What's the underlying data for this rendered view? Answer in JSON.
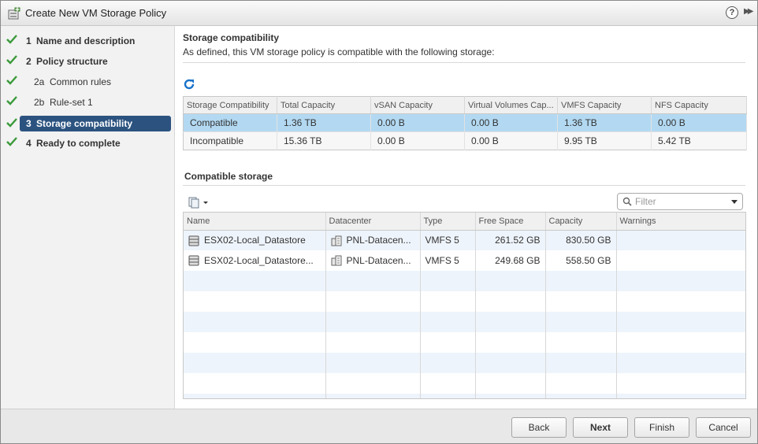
{
  "window": {
    "title": "Create New VM Storage Policy"
  },
  "nav": {
    "steps": [
      {
        "num": "1",
        "label": "Name and description"
      },
      {
        "num": "2",
        "label": "Policy structure"
      },
      {
        "num": "2a",
        "label": "Common rules"
      },
      {
        "num": "2b",
        "label": "Rule-set 1"
      },
      {
        "num": "3",
        "label": "Storage compatibility"
      },
      {
        "num": "4",
        "label": "Ready to complete"
      }
    ]
  },
  "compat": {
    "heading": "Storage compatibility",
    "description": "As defined, this VM storage policy is compatible with the following storage:",
    "columns": [
      "Storage Compatibility",
      "Total Capacity",
      "vSAN Capacity",
      "Virtual Volumes Cap...",
      "VMFS Capacity",
      "NFS Capacity"
    ],
    "rows": [
      [
        "Compatible",
        "1.36 TB",
        "0.00 B",
        "0.00 B",
        "1.36 TB",
        "0.00 B"
      ],
      [
        "Incompatible",
        "15.36 TB",
        "0.00 B",
        "0.00 B",
        "9.95 TB",
        "5.42 TB"
      ]
    ]
  },
  "storage": {
    "heading": "Compatible storage",
    "filter_placeholder": "Filter",
    "columns": [
      "Name",
      "Datacenter",
      "Type",
      "Free Space",
      "Capacity",
      "Warnings"
    ],
    "rows": [
      [
        "ESX02-Local_Datastore",
        "PNL-Datacen...",
        "VMFS 5",
        "261.52 GB",
        "830.50 GB",
        ""
      ],
      [
        "ESX02-Local_Datastore...",
        "PNL-Datacen...",
        "VMFS 5",
        "249.68 GB",
        "558.50 GB",
        ""
      ]
    ]
  },
  "footer": {
    "back": "Back",
    "next": "Next",
    "finish": "Finish",
    "cancel": "Cancel"
  },
  "colors": {
    "accent": "#2c5380",
    "selected_row": "#b3d9f2",
    "check": "#3a9a3a"
  },
  "icons": [
    "storage-policy-icon",
    "help-icon",
    "collapse-icon",
    "check-icon",
    "refresh-icon",
    "actions-icon",
    "search-icon",
    "datastore-icon",
    "datacenter-icon"
  ]
}
